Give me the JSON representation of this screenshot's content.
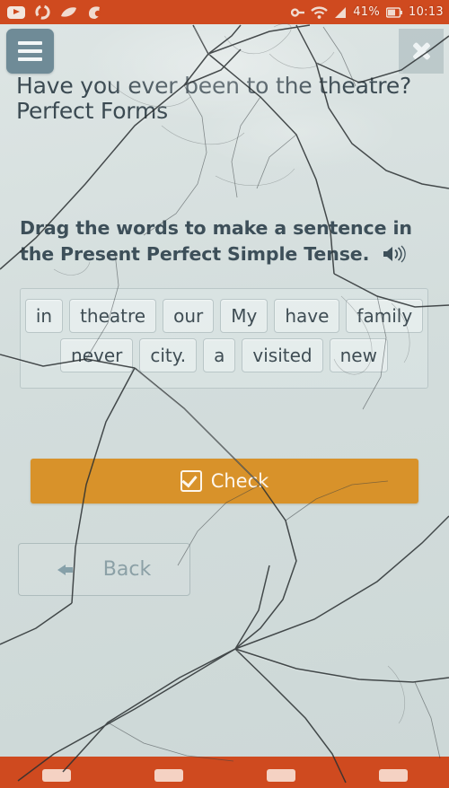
{
  "statusbar": {
    "icons": [
      "youtube-play-icon",
      "sync-circle-icon",
      "leaf-icon",
      "app-badge-icon",
      "vpn-key-icon",
      "wifi-icon",
      "signal-icon"
    ],
    "battery": "41%",
    "time": "10:13"
  },
  "header": {
    "menu_icon": "hamburger-menu-icon",
    "close_icon": "close-x-icon",
    "title_line1": "Have you ever been to the theatre?",
    "title_line2": "Perfect Forms"
  },
  "instruction": {
    "text": "Drag the words to make a sentence in the Present Perfect Simple Tense.",
    "audio_icon": "speaker-icon"
  },
  "wordbank": {
    "rows": [
      [
        "in",
        "theatre",
        "our",
        "My",
        "have",
        "family"
      ],
      [
        "never",
        "city.",
        "a",
        "visited",
        "new"
      ]
    ]
  },
  "buttons": {
    "check_label": "Check",
    "check_icon": "checkbox-checked-icon",
    "check_color": "#d8922a",
    "back_label": "Back",
    "back_icon": "arrow-left-icon"
  },
  "colors": {
    "status_bar": "#cf4a1f",
    "background": "#d3dedd",
    "accent_orange": "#d8922a",
    "menu_button": "#6f8b97",
    "text_dark": "#3b4a52",
    "text_muted": "#8ba0a6"
  },
  "navbar": {
    "keys": [
      "back-nav-key",
      "home-nav-key",
      "recents-nav-key",
      "extra-nav-key"
    ]
  }
}
